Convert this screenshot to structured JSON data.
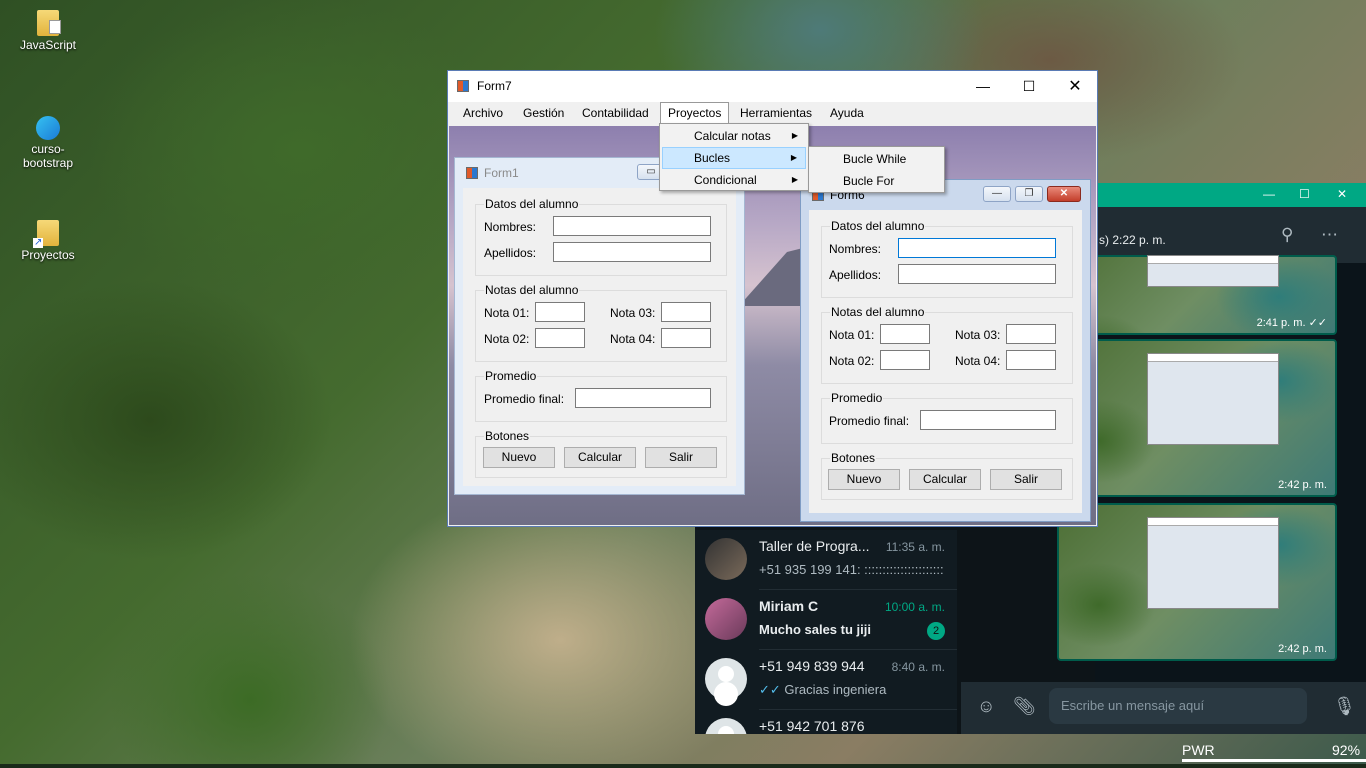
{
  "desktop": {
    "icons": [
      {
        "label": "JavaScript",
        "icon": "folder-icon"
      },
      {
        "label": "curso-bootstrap",
        "icon": "edge-icon"
      },
      {
        "label": "Proyectos",
        "icon": "folder-shortcut-icon"
      }
    ]
  },
  "form7": {
    "title": "Form7",
    "menu": [
      "Archivo",
      "Gestión",
      "Contabilidad",
      "Proyectos",
      "Herramientas",
      "Ayuda"
    ],
    "proyectos_menu": [
      {
        "label": "Calcular notas",
        "has_submenu": true
      },
      {
        "label": "Bucles",
        "has_submenu": true
      },
      {
        "label": "Condicional",
        "has_submenu": true
      }
    ],
    "bucles_submenu": [
      "Bucle While",
      "Bucle For"
    ]
  },
  "form1": {
    "title": "Form1",
    "datos_group": "Datos del alumno",
    "nombres_label": "Nombres:",
    "apellidos_label": "Apellidos:",
    "notas_group": "Notas del alumno",
    "nota01_label": "Nota 01:",
    "nota02_label": "Nota 02:",
    "nota03_label": "Nota 03:",
    "nota04_label": "Nota 04:",
    "promedio_group": "Promedio",
    "promedio_label": "Promedio final:",
    "botones_group": "Botones",
    "nuevo": "Nuevo",
    "calcular": "Calcular",
    "salir": "Salir"
  },
  "form6": {
    "title": "Form6",
    "datos_group": "Datos del alumno",
    "nombres_label": "Nombres:",
    "apellidos_label": "Apellidos:",
    "notas_group": "Notas del alumno",
    "nota01_label": "Nota 01:",
    "nota02_label": "Nota 02:",
    "nota03_label": "Nota 03:",
    "nota04_label": "Nota 04:",
    "promedio_group": "Promedio",
    "promedio_label": "Promedio final:",
    "botones_group": "Botones",
    "nuevo": "Nuevo",
    "calcular": "Calcular",
    "salir": "Salir"
  },
  "whatsapp": {
    "last_seen": "s) 2:22 p. m.",
    "images": [
      {
        "time": "2:41 p. m. ✓✓"
      },
      {
        "time": "2:42 p. m."
      },
      {
        "time": "2:42 p. m."
      }
    ],
    "chats": [
      {
        "name": "Taller de Progra...",
        "time": "11:35 a. m.",
        "message": "+51 935 199 141: ::::::::::::::::::::::"
      },
      {
        "name": "Miriam C",
        "time": "10:00 a. m.",
        "message": "Mucho sales tu jiji",
        "badge": "2"
      },
      {
        "name": "+51 949 839 944",
        "time": "8:40 a. m.",
        "message": "Gracias ingeniera"
      },
      {
        "name": "+51 942 701 876",
        "time": "",
        "message": ""
      }
    ],
    "input_placeholder": "Escribe un mensaje aquí"
  },
  "tray": {
    "power_label": "PWR",
    "battery": "92%"
  }
}
